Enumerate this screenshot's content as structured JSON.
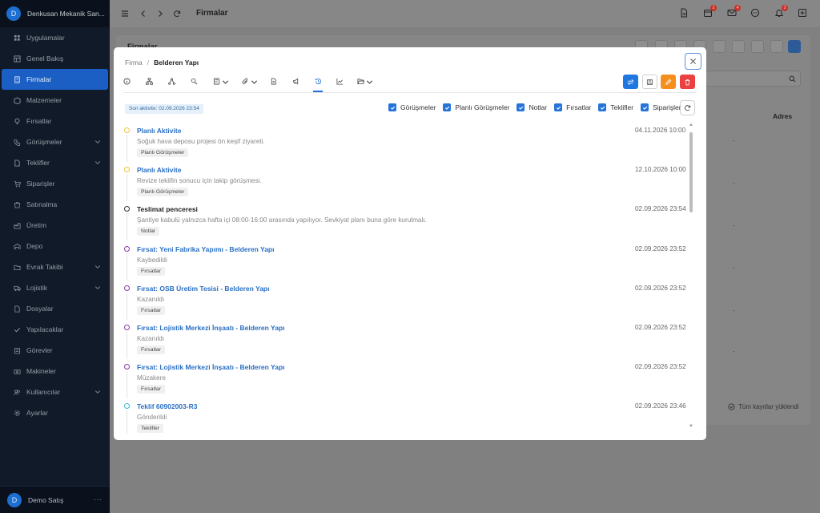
{
  "sidebar": {
    "company": "Denkusan Mekanik San...",
    "avatar": "D",
    "items": [
      {
        "label": "Uygulamalar",
        "icon": "grid-icon",
        "chevron": false
      },
      {
        "label": "Genel Bakış",
        "icon": "dashboard-icon",
        "chevron": false
      },
      {
        "label": "Firmalar",
        "icon": "building-icon",
        "chevron": false,
        "active": true
      },
      {
        "label": "Malzemeler",
        "icon": "box-icon",
        "chevron": false
      },
      {
        "label": "Fırsatlar",
        "icon": "lightbulb-icon",
        "chevron": false
      },
      {
        "label": "Görüşmeler",
        "icon": "phone-icon",
        "chevron": true
      },
      {
        "label": "Teklifler",
        "icon": "document-icon",
        "chevron": true
      },
      {
        "label": "Siparişler",
        "icon": "cart-icon",
        "chevron": false
      },
      {
        "label": "Satınalma",
        "icon": "shopping-icon",
        "chevron": false
      },
      {
        "label": "Üretim",
        "icon": "factory-icon",
        "chevron": false
      },
      {
        "label": "Depo",
        "icon": "warehouse-icon",
        "chevron": false
      },
      {
        "label": "Evrak Takibi",
        "icon": "folder-icon",
        "chevron": true
      },
      {
        "label": "Lojistik",
        "icon": "truck-icon",
        "chevron": true
      },
      {
        "label": "Dosyalar",
        "icon": "file-icon",
        "chevron": false
      },
      {
        "label": "Yapılacaklar",
        "icon": "check-icon",
        "chevron": false
      },
      {
        "label": "Görevler",
        "icon": "tasks-icon",
        "chevron": false
      },
      {
        "label": "Makineler",
        "icon": "machine-icon",
        "chevron": false
      },
      {
        "label": "Kullanıcılar",
        "icon": "users-icon",
        "chevron": true
      },
      {
        "label": "Ayarlar",
        "icon": "gear-icon",
        "chevron": false
      }
    ],
    "user": {
      "avatar": "D",
      "name": "Demo Satış",
      "more": "···"
    }
  },
  "topbar": {
    "title": "Firmalar",
    "badges": {
      "calendar": "2",
      "mail": "4",
      "bell": "3"
    }
  },
  "background": {
    "title": "Firmalar",
    "column_header": "Adres",
    "row_value": "-",
    "loaded_text": "Tüm kayıtlar yüklendi"
  },
  "modal": {
    "breadcrumb_parent": "Firma",
    "breadcrumb_sep": "/",
    "breadcrumb_current": "Belderen Yapı",
    "last_activity": "Son aktivite: 02.09.2026 23:54",
    "filters": [
      "Görüşmeler",
      "Planlı Görüşmeler",
      "Notlar",
      "Fırsatlar",
      "Teklifler",
      "Siparişler"
    ],
    "events": [
      {
        "title": "Planlı Aktivite",
        "desc": "Soğuk hava deposu projesi ön keşif ziyareti.",
        "tag": "Planlı Görüşmeler",
        "date": "04.11.2026 10:00",
        "color": "#f0c53a",
        "link": true
      },
      {
        "title": "Planlı Aktivite",
        "desc": "Revize teklifin sonucu için takip görüşmesi.",
        "tag": "Planlı Görüşmeler",
        "date": "12.10.2026 10:00",
        "color": "#f0c53a",
        "link": true
      },
      {
        "title": "Teslimat penceresi",
        "desc": "Şantiye kabulü yalnızca hafta içi 08:00-16:00 arasında yapılıyor. Sevkiyat planı buna göre kurulmalı.",
        "tag": "Notlar",
        "date": "02.09.2026 23:54",
        "color": "#333333",
        "link": false
      },
      {
        "title": "Fırsat: Yeni Fabrika Yapımı - Belderen Yapı",
        "desc": "Kaybedildi",
        "tag": "Fırsatlar",
        "date": "02.09.2026 23:52",
        "color": "#8a3aa3",
        "link": true
      },
      {
        "title": "Fırsat: OSB Üretim Tesisi - Belderen Yapı",
        "desc": "Kazanıldı",
        "tag": "Fırsatlar",
        "date": "02.09.2026 23:52",
        "color": "#8a3aa3",
        "link": true
      },
      {
        "title": "Fırsat: Lojistik Merkezi İnşaatı - Belderen Yapı",
        "desc": "Kazanıldı",
        "tag": "Fırsatlar",
        "date": "02.09.2026 23:52",
        "color": "#8a3aa3",
        "link": true
      },
      {
        "title": "Fırsat: Lojistik Merkezi İnşaatı - Belderen Yapı",
        "desc": "Müzakere",
        "tag": "Fırsatlar",
        "date": "02.09.2026 23:52",
        "color": "#8a3aa3",
        "link": true
      },
      {
        "title": "Teklif 60902003-R3",
        "desc": "Gönderildi",
        "tag": "Teklifler",
        "date": "02.09.2026 23:46",
        "color": "#3ab8d6",
        "link": true
      }
    ]
  }
}
